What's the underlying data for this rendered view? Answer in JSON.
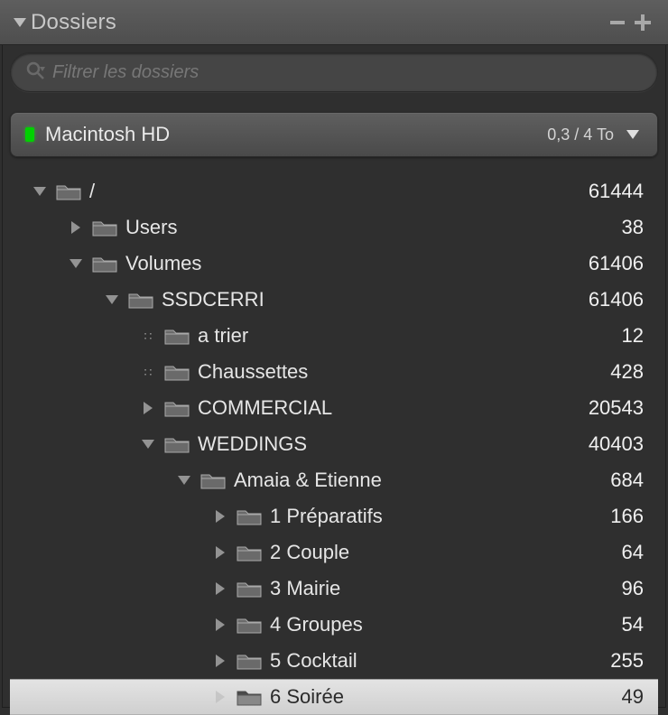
{
  "panel": {
    "title": "Dossiers",
    "search_placeholder": "Filtrer les dossiers"
  },
  "volume": {
    "name": "Macintosh HD",
    "space": "0,3 / 4 To"
  },
  "tree": [
    {
      "depth": 0,
      "state": "open",
      "name": "/",
      "count": "61444",
      "selected": false
    },
    {
      "depth": 1,
      "state": "closed",
      "name": "Users",
      "count": "38",
      "selected": false
    },
    {
      "depth": 1,
      "state": "open",
      "name": "Volumes",
      "count": "61406",
      "selected": false
    },
    {
      "depth": 2,
      "state": "open",
      "name": "SSDCERRI",
      "count": "61406",
      "selected": false
    },
    {
      "depth": 3,
      "state": "leaf",
      "name": "a trier",
      "count": "12",
      "selected": false
    },
    {
      "depth": 3,
      "state": "leaf",
      "name": "Chaussettes",
      "count": "428",
      "selected": false
    },
    {
      "depth": 3,
      "state": "closed",
      "name": "COMMERCIAL",
      "count": "20543",
      "selected": false
    },
    {
      "depth": 3,
      "state": "open",
      "name": "WEDDINGS",
      "count": "40403",
      "selected": false
    },
    {
      "depth": 4,
      "state": "open",
      "name": "Amaia & Etienne",
      "count": "684",
      "selected": false
    },
    {
      "depth": 5,
      "state": "closed",
      "name": "1 Préparatifs",
      "count": "166",
      "selected": false
    },
    {
      "depth": 5,
      "state": "closed",
      "name": "2 Couple",
      "count": "64",
      "selected": false
    },
    {
      "depth": 5,
      "state": "closed",
      "name": "3 Mairie",
      "count": "96",
      "selected": false
    },
    {
      "depth": 5,
      "state": "closed",
      "name": "4 Groupes",
      "count": "54",
      "selected": false
    },
    {
      "depth": 5,
      "state": "closed",
      "name": "5 Cocktail",
      "count": "255",
      "selected": false
    },
    {
      "depth": 5,
      "state": "closed",
      "name": "6 Soirée",
      "count": "49",
      "selected": true
    }
  ]
}
